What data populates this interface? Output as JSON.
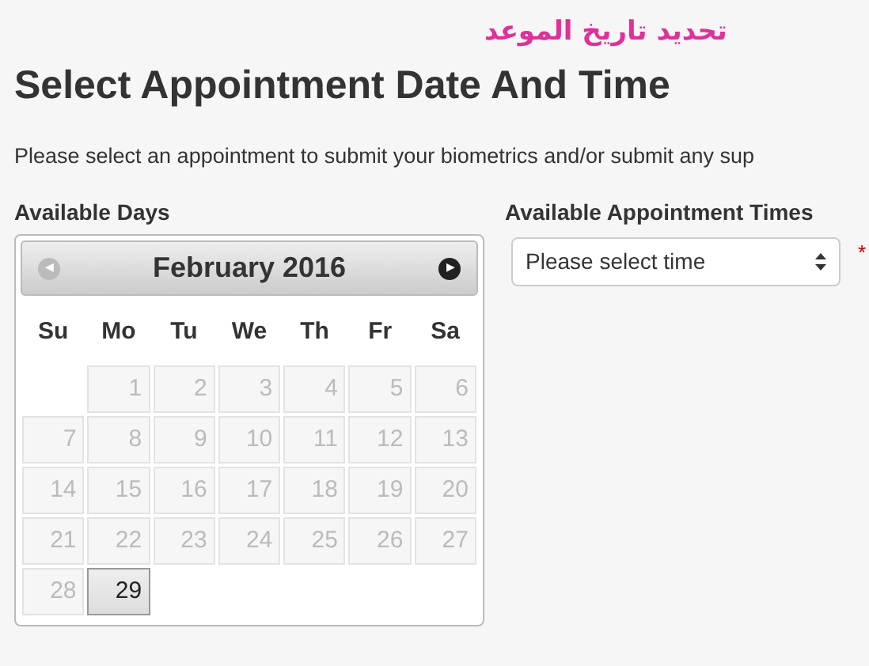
{
  "caption": "تحديد تاريخ الموعد",
  "heading": "Select Appointment Date And Time",
  "intro": "Please select an appointment to submit your biometrics and/or submit any sup",
  "days_panel": {
    "label": "Available Days",
    "calendar": {
      "prev": "◀",
      "month": "February 2016",
      "next": "▶",
      "weekdays": [
        "Su",
        "Mo",
        "Tu",
        "We",
        "Th",
        "Fr",
        "Sa"
      ],
      "weeks": [
        [
          {
            "kind": "blank"
          },
          {
            "day": "1",
            "disabled": true
          },
          {
            "day": "2",
            "disabled": true
          },
          {
            "day": "3",
            "disabled": true
          },
          {
            "day": "4",
            "disabled": true
          },
          {
            "day": "5",
            "disabled": true
          },
          {
            "day": "6",
            "disabled": true
          }
        ],
        [
          {
            "day": "7",
            "disabled": true
          },
          {
            "day": "8",
            "disabled": true
          },
          {
            "day": "9",
            "disabled": true
          },
          {
            "day": "10",
            "disabled": true
          },
          {
            "day": "11",
            "disabled": true
          },
          {
            "day": "12",
            "disabled": true
          },
          {
            "day": "13",
            "disabled": true
          }
        ],
        [
          {
            "day": "14",
            "disabled": true
          },
          {
            "day": "15",
            "disabled": true
          },
          {
            "day": "16",
            "disabled": true
          },
          {
            "day": "17",
            "disabled": true
          },
          {
            "day": "18",
            "disabled": true
          },
          {
            "day": "19",
            "disabled": true
          },
          {
            "day": "20",
            "disabled": true
          }
        ],
        [
          {
            "day": "21",
            "disabled": true
          },
          {
            "day": "22",
            "disabled": true
          },
          {
            "day": "23",
            "disabled": true
          },
          {
            "day": "24",
            "disabled": true
          },
          {
            "day": "25",
            "disabled": true
          },
          {
            "day": "26",
            "disabled": true
          },
          {
            "day": "27",
            "disabled": true
          }
        ],
        [
          {
            "day": "28",
            "disabled": true
          },
          {
            "day": "29",
            "disabled": false
          }
        ]
      ]
    }
  },
  "times_panel": {
    "label": "Available Appointment Times",
    "select": {
      "value": "Please select time"
    },
    "required_mark": "*"
  }
}
